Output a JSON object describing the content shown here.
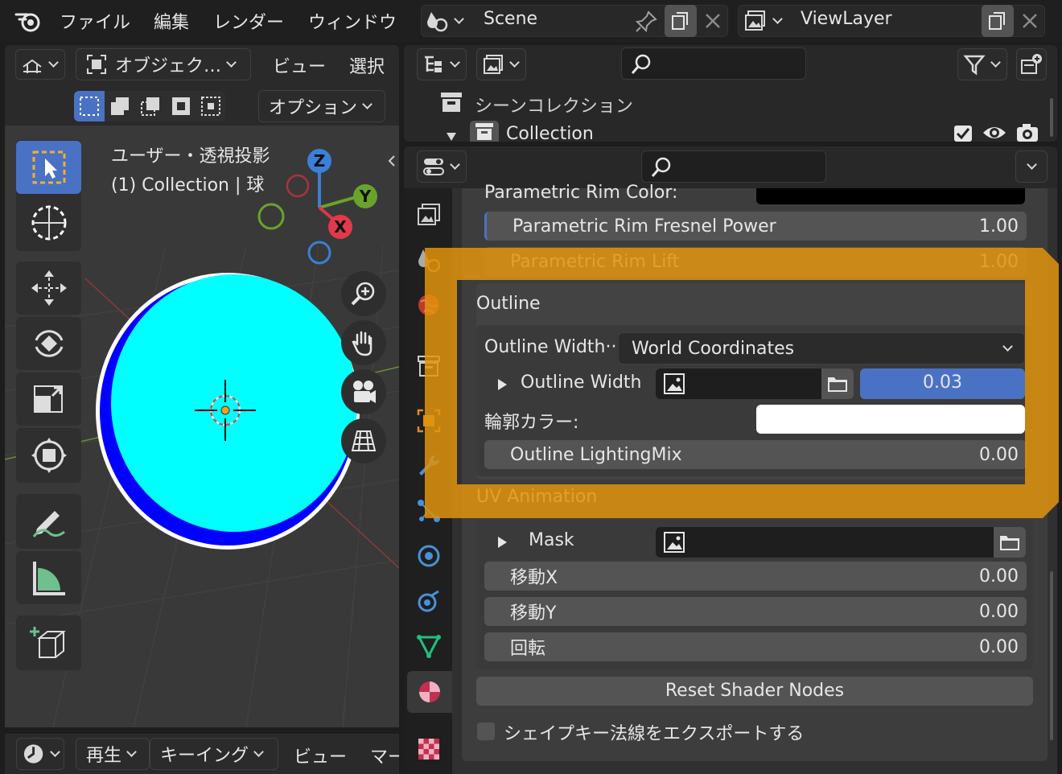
{
  "top_menu": {
    "items": [
      "ファイル",
      "編集",
      "レンダー",
      "ウィンドウ"
    ]
  },
  "scene": {
    "name": "Scene"
  },
  "view_layer": {
    "name": "ViewLayer"
  },
  "viewport_header": {
    "mode_label": "オブジェク…",
    "view_label": "ビュー",
    "select_label": "選択",
    "options_label": "オプション"
  },
  "viewport": {
    "view_name": "ユーザー・透視投影",
    "object_info": "(1) Collection | 球",
    "gizmo": {
      "z": "Z",
      "y": "Y",
      "x": "X"
    },
    "colors": {
      "sphere": "#00ffff",
      "sphere_shadow": "#0000ff",
      "outline": "#ffffff",
      "background": "#393939"
    }
  },
  "timeline": {
    "play_label": "再生",
    "keying_label": "キーイング",
    "view_label": "ビュー",
    "marker_label": "マー"
  },
  "outliner": {
    "scene_collection": "シーンコレクション",
    "collection": "Collection"
  },
  "properties": {
    "rim_color_label": "Parametric Rim Color:",
    "rim_fresnel": {
      "label": "Parametric Rim Fresnel Power",
      "value": "1.00"
    },
    "rim_lift": {
      "label": "Parametric Rim Lift",
      "value": "1.00"
    },
    "outline_header": "Outline",
    "outline_width_mode": {
      "label": "Outline Width···",
      "value": "World Coordinates"
    },
    "outline_width": {
      "label": "Outline Width",
      "value": "0.03"
    },
    "outline_color_label": "輪郭カラー:",
    "outline_lighting_mix": {
      "label": "Outline LightingMix",
      "value": "0.00"
    },
    "uv_animation_header": "UV Animation",
    "mask_label": "Mask",
    "move_x": {
      "label": "移動X",
      "value": "0.00"
    },
    "move_y": {
      "label": "移動Y",
      "value": "0.00"
    },
    "rotate": {
      "label": "回転",
      "value": "0.00"
    },
    "reset_button": "Reset Shader Nodes",
    "export_checkbox": "シェイプキー法線をエクスポートする"
  },
  "highlight": {
    "color": "#e0930d"
  }
}
